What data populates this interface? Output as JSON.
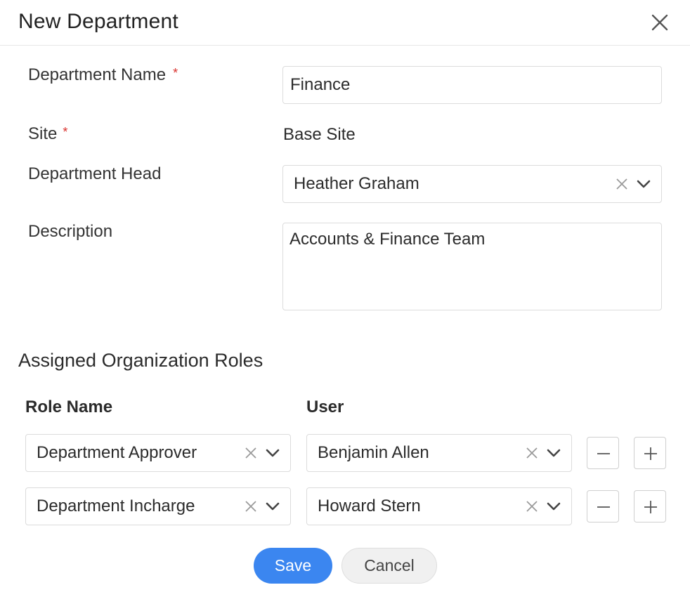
{
  "dialog": {
    "title": "New Department",
    "close_icon": "close-icon"
  },
  "form": {
    "department_name": {
      "label": "Department Name",
      "required": "*",
      "value": "Finance"
    },
    "site": {
      "label": "Site",
      "required": "*",
      "value": "Base Site"
    },
    "department_head": {
      "label": "Department Head",
      "value": "Heather Graham"
    },
    "description": {
      "label": "Description",
      "value": "Accounts & Finance Team"
    }
  },
  "roles": {
    "section_title": "Assigned Organization Roles",
    "col_role": "Role Name",
    "col_user": "User",
    "rows": [
      {
        "role": "Department Approver",
        "user": "Benjamin Allen"
      },
      {
        "role": "Department Incharge",
        "user": "Howard Stern"
      }
    ]
  },
  "actions": {
    "save_label": "Save",
    "cancel_label": "Cancel"
  },
  "colors": {
    "primary": "#3b86f0",
    "required": "#d9302c",
    "border": "#dcdcdc"
  }
}
